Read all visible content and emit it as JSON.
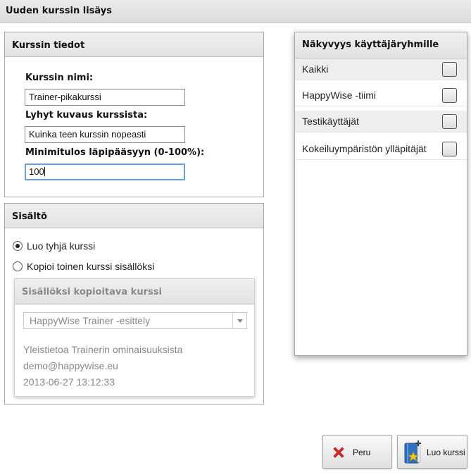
{
  "window": {
    "title": "Uuden kurssin lisäys"
  },
  "course_info": {
    "header": "Kurssin tiedot",
    "name_label": "Kurssin nimi:",
    "name_value": "Trainer-pikakurssi",
    "desc_label": "Lyhyt kuvaus kurssista:",
    "desc_value": "Kuinka teen kurssin nopeasti",
    "min_label": "Minimitulos läpipääsyyn (0-100%):",
    "min_value": "100"
  },
  "content": {
    "header": "Sisältö",
    "option_empty": "Luo tyhjä kurssi",
    "option_copy": "Kopioi toinen kurssi sisällöksi",
    "selected_option": "empty",
    "copy_section": {
      "header": "Sisällöksi kopioitava kurssi",
      "selected_course": "HappyWise Trainer -esittely",
      "description": "Yleistietoa Trainerin ominaisuuksista",
      "email": "demo@happywise.eu",
      "date": "2013-06-27 13:12:33"
    }
  },
  "visibility": {
    "header": "Näkyvyys käyttäjäryhmille",
    "groups": [
      {
        "label": "Kaikki",
        "checked": false
      },
      {
        "label": "HappyWise -tiimi",
        "checked": false
      },
      {
        "label": "Testikäyttäjät",
        "checked": false
      },
      {
        "label": "Kokeiluympäristön ylläpitäjät",
        "checked": false
      }
    ]
  },
  "buttons": {
    "cancel": "Peru",
    "create": "Luo kurssi"
  },
  "icons": {
    "cancel": "red-x-icon",
    "create": "book-star-icon"
  },
  "colors": {
    "focus_border": "#6a9fd8",
    "cancel_icon": "#e0242b",
    "book_blue": "#2f6fc0",
    "star_yellow": "#f5c518"
  }
}
